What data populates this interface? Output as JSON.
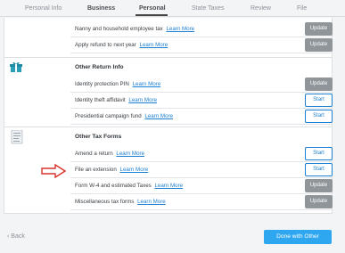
{
  "nav": {
    "tabs": [
      {
        "label": "Personal Info"
      },
      {
        "label": "Business"
      },
      {
        "label": "Personal"
      },
      {
        "label": "State Taxes"
      },
      {
        "label": "Review"
      },
      {
        "label": "File"
      }
    ],
    "active": "Personal"
  },
  "top_rows": [
    {
      "label": "Nanny and household employee tax",
      "link": "Learn More",
      "button": "Update"
    },
    {
      "label": "Apply refund to next year",
      "link": "Learn More",
      "button": "Update"
    }
  ],
  "other_return_info": {
    "title": "Other Return Info",
    "icon": "gift-box-icon",
    "rows": [
      {
        "label": "Identity protection PIN",
        "link": "Learn More",
        "button": "Update"
      },
      {
        "label": "Identity theft affidavit",
        "link": "Learn More",
        "button": "Start"
      },
      {
        "label": "Presidential campaign fund",
        "link": "Learn More",
        "button": "Start"
      }
    ]
  },
  "other_tax_forms": {
    "title": "Other Tax Forms",
    "icon": "document-icon",
    "rows": [
      {
        "label": "Amend a return",
        "link": "Learn More",
        "button": "Start"
      },
      {
        "label": "File an extension",
        "link": "Learn More",
        "button": "Start"
      },
      {
        "label": "Form W-4 and estimated Taxes",
        "link": "Learn More",
        "button": "Update"
      },
      {
        "label": "Miscellaneous tax forms",
        "link": "Learn More",
        "button": "Update"
      }
    ]
  },
  "footer": {
    "back": "‹ Back",
    "done": "Done with Other"
  },
  "colors": {
    "accent": "#2ea7f0",
    "link": "#1c7fd1",
    "update_button": "#8f9599",
    "arrow": "#d9322c"
  }
}
